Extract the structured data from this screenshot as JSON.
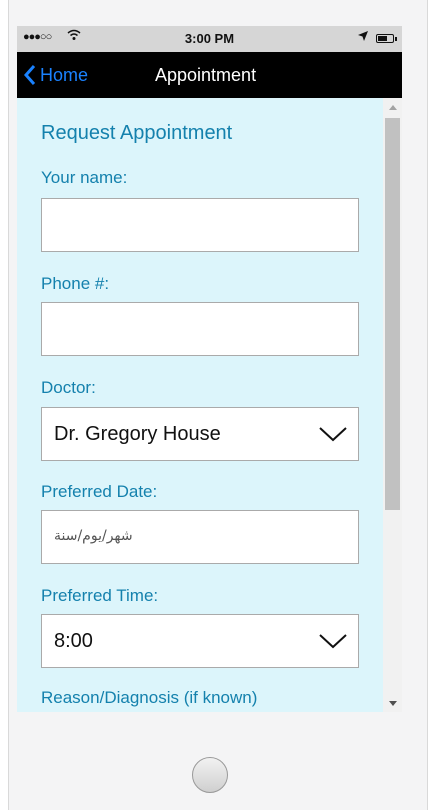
{
  "status_bar": {
    "signal": "●●●○○",
    "time": "3:00 PM",
    "battery_level": 0.65
  },
  "nav": {
    "back_label": "Home",
    "title": "Appointment"
  },
  "form": {
    "title": "Request Appointment",
    "name_label": "Your name:",
    "name_value": "",
    "phone_label": "Phone #:",
    "phone_value": "",
    "doctor_label": "Doctor:",
    "doctor_value": "Dr. Gregory House",
    "date_label": "Preferred Date:",
    "date_placeholder": "شهر/يوم/سنة",
    "time_label": "Preferred Time:",
    "time_value": "8:00",
    "reason_label": "Reason/Diagnosis (if known)"
  },
  "colors": {
    "accent": "#1481ad",
    "link": "#1a82ff",
    "content_bg": "#dcf5fb",
    "nav_bg": "#000000"
  }
}
